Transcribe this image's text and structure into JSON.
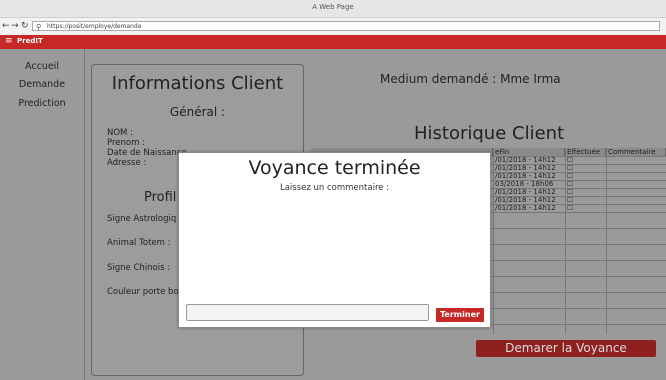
{
  "window": {
    "title": "A Web Page"
  },
  "browser": {
    "back": "←",
    "forward": "→",
    "reload": "↻",
    "url": "https://posit/employe/demande"
  },
  "appbar": {
    "menu": "≡",
    "brand": "PredIT"
  },
  "sidebar": {
    "items": [
      {
        "label": "Accueil"
      },
      {
        "label": "Demande"
      },
      {
        "label": "Prediction"
      }
    ]
  },
  "client_panel": {
    "title": "Informations Client",
    "general_heading": "Général :",
    "fields": {
      "nom": "NOM :",
      "prenom": "Prenom :",
      "naissance": "Date de Naissance",
      "adresse": "Adresse :"
    },
    "profil_heading": "Profil A",
    "profil_fields": {
      "signe_astro": "Signe Astrologiq",
      "animal_totem": "Animal Totem :",
      "signe_chinois": "Signe Chinois :",
      "couleur": "Couleur porte bo"
    }
  },
  "medium": {
    "label": "Medium demandé : Mme Irma"
  },
  "history": {
    "title": "Historique Client",
    "columns": [
      "eFin",
      "Effectuée",
      "Commentaire"
    ],
    "rows": [
      {
        "fin": "/01/2018 - 14h12",
        "effectuee": "☐"
      },
      {
        "fin": "/01/2018 - 14h12",
        "effectuee": "☐"
      },
      {
        "fin": "/01/2018 - 14h12",
        "effectuee": "☐"
      },
      {
        "fin": "03/2018 - 18h06",
        "effectuee": "☐"
      },
      {
        "fin": "/01/2018 - 14h12",
        "effectuee": "☐"
      },
      {
        "fin": "/01/2018 - 14h12",
        "effectuee": "☐"
      },
      {
        "fin": "/01/2018 - 14h12",
        "effectuee": "☐"
      }
    ]
  },
  "start_button": {
    "label": "Demarer la Voyance"
  },
  "modal": {
    "title": "Voyance terminée",
    "subtitle": "Laissez un commentaire :",
    "comment_value": "",
    "submit_label": "Terminer"
  },
  "colors": {
    "accent": "#c62828",
    "start_button": "#8f2020",
    "background": "#9a9a9a"
  }
}
